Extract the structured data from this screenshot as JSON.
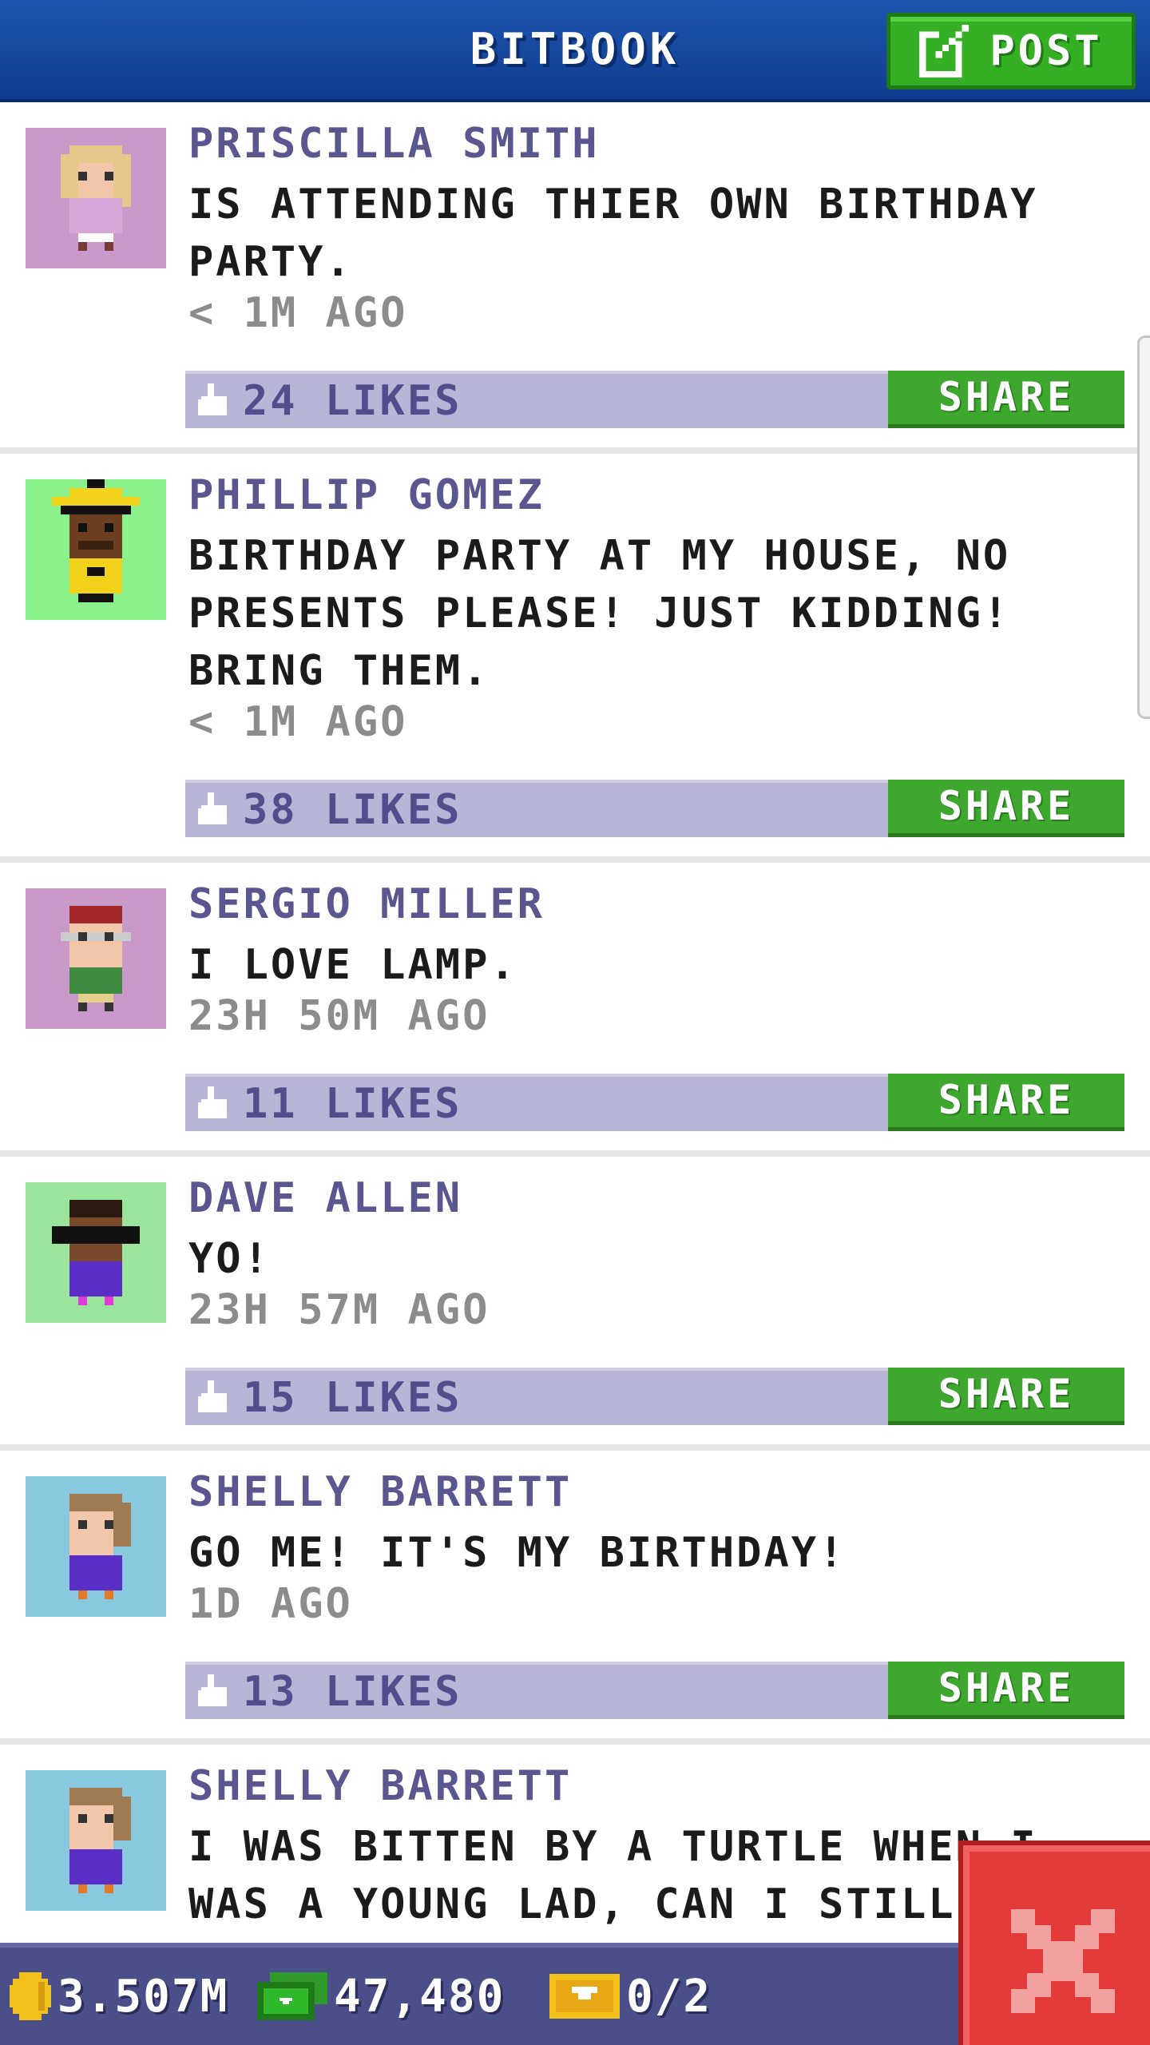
{
  "header": {
    "title": "BITBOOK",
    "post_label": "POST"
  },
  "colors": {
    "header_blue": "#1f55b0",
    "button_green": "#3ea82e",
    "likes_bar": "#b7b6d6",
    "author_text": "#5a5690",
    "bottom_bar": "#4a4f8a",
    "close_red": "#e33a3a"
  },
  "posts": [
    {
      "author": "PRISCILLA SMITH",
      "message": "IS ATTENDING THIER OWN BIRTHDAY PARTY.",
      "time": "< 1M AGO",
      "likes": "24 LIKES",
      "share_label": "SHARE",
      "avatar_bg": "#c99ac9"
    },
    {
      "author": "PHILLIP GOMEZ",
      "message": "BIRTHDAY PARTY AT MY HOUSE, NO PRESENTS PLEASE! JUST KIDDING! BRING THEM.",
      "time": "< 1M AGO",
      "likes": "38 LIKES",
      "share_label": "SHARE",
      "avatar_bg": "#8bf28b"
    },
    {
      "author": "SERGIO MILLER",
      "message": "I LOVE LAMP.",
      "time": "23H 50M AGO",
      "likes": "11 LIKES",
      "share_label": "SHARE",
      "avatar_bg": "#c99ac9"
    },
    {
      "author": "DAVE ALLEN",
      "message": "YO!",
      "time": "23H 57M AGO",
      "likes": "15 LIKES",
      "share_label": "SHARE",
      "avatar_bg": "#9be49b"
    },
    {
      "author": "SHELLY BARRETT",
      "message": "GO ME! IT'S MY BIRTHDAY!",
      "time": "1D AGO",
      "likes": "13 LIKES",
      "share_label": "SHARE",
      "avatar_bg": "#89c9e0"
    },
    {
      "author": "SHELLY BARRETT",
      "message": "I WAS BITTEN BY A TURTLE WHEN I WAS A YOUNG LAD, CAN I STILL DRIN",
      "avatar_bg": "#89c9e0"
    }
  ],
  "bottom_bar": {
    "coins": "3.507M",
    "bux": "47,480",
    "tickets": "0/2"
  },
  "icons": {
    "post": "edit-icon",
    "like": "thumbs-up-icon",
    "coins": "coin-icon",
    "bux": "bux-icon",
    "tickets": "ticket-icon",
    "close": "close-icon"
  }
}
